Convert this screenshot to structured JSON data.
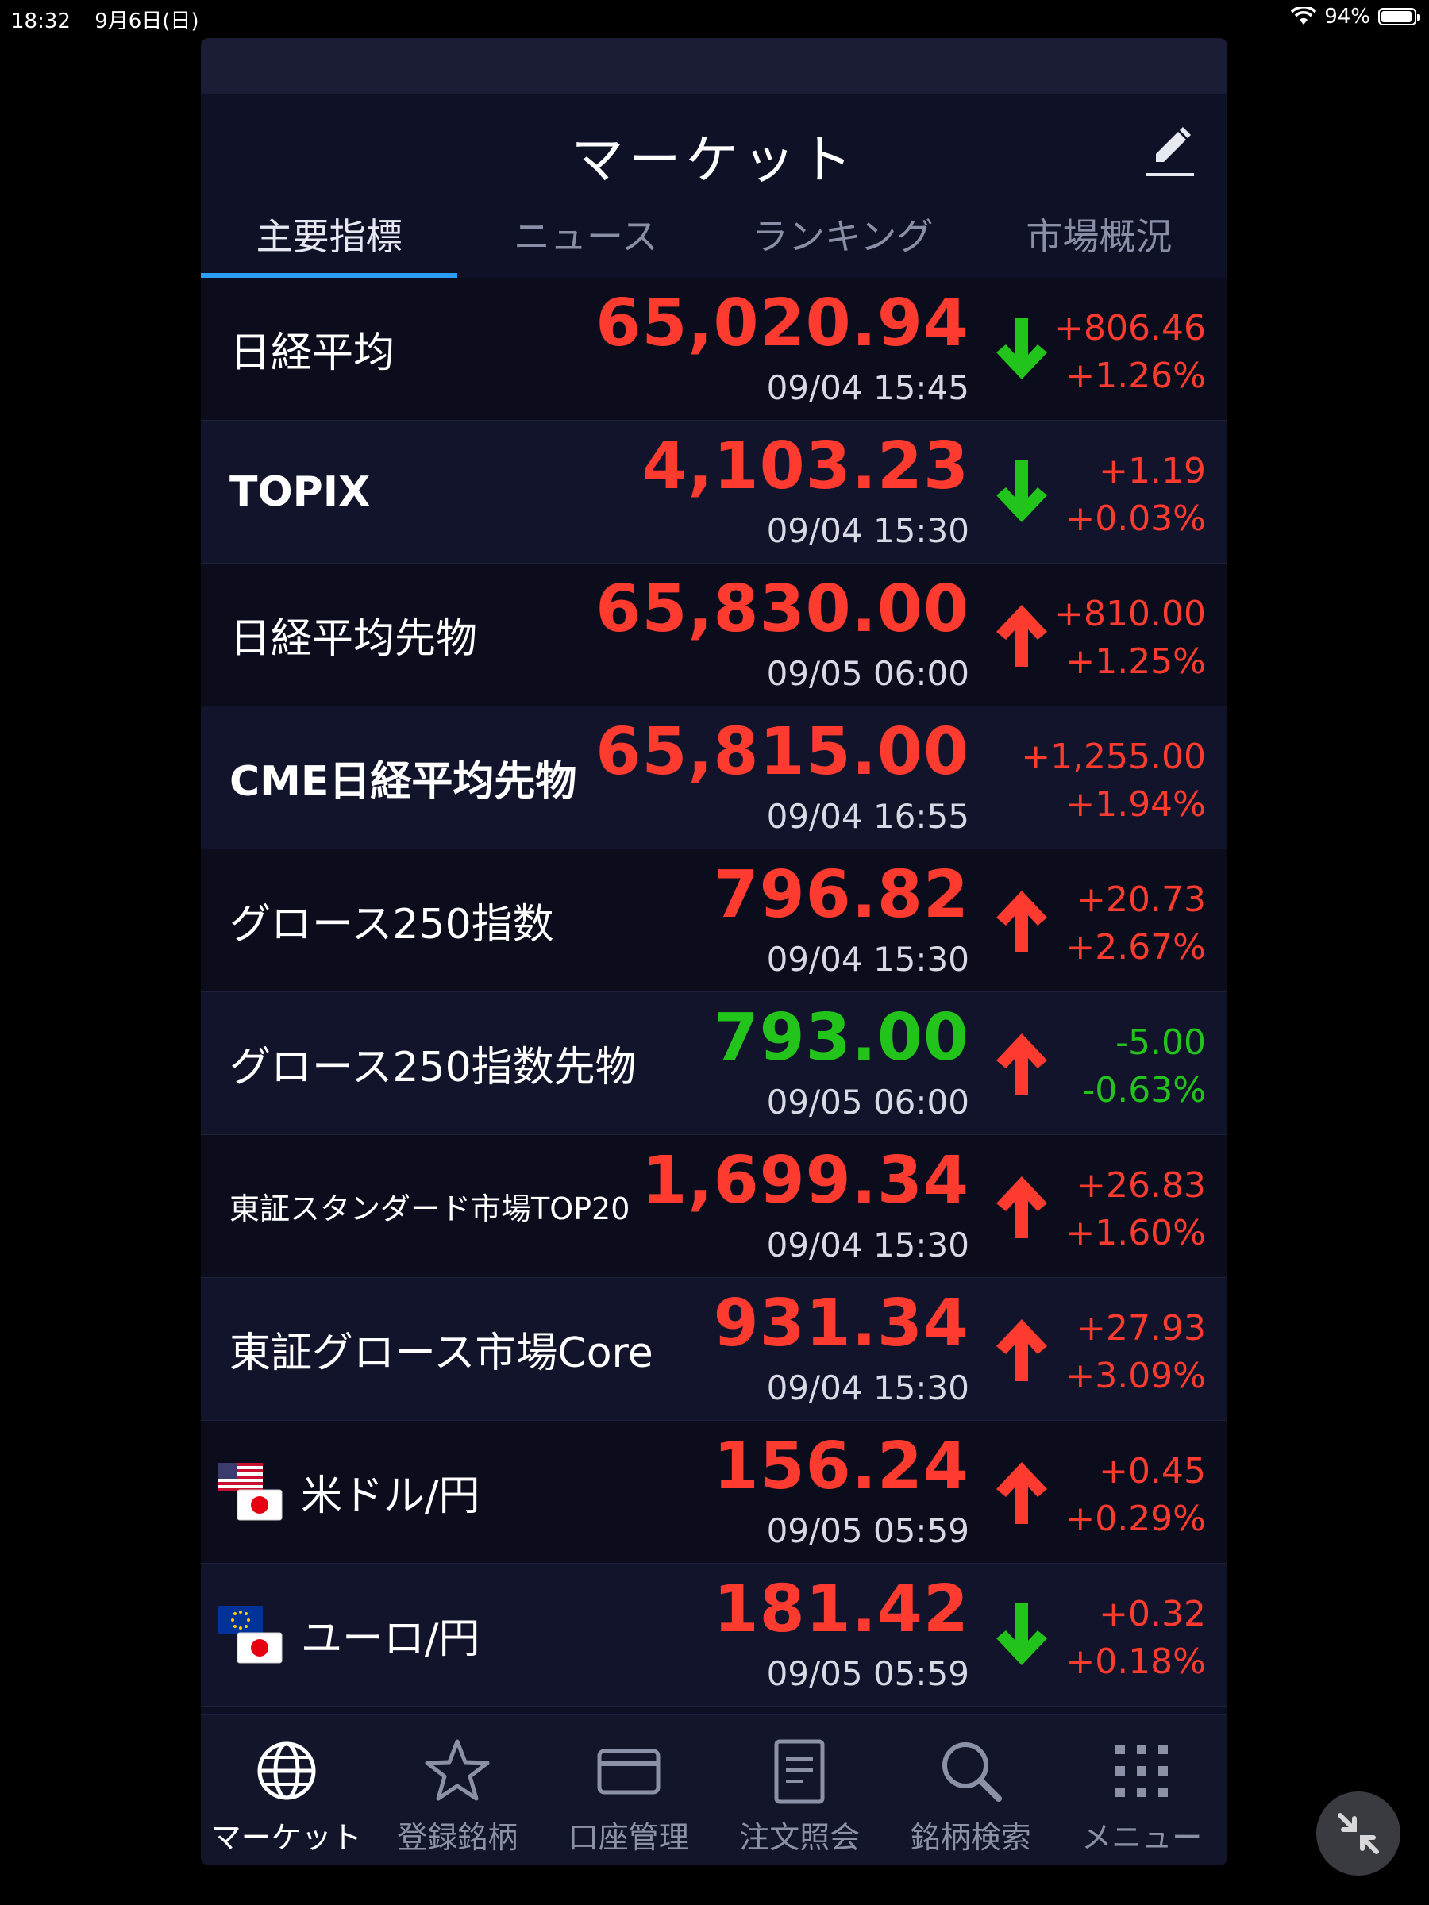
{
  "status_bar": {
    "time": "18:32",
    "date": "9月6日(日)",
    "battery": "94%",
    "battery_level": 0.94
  },
  "header": {
    "title": "マーケット"
  },
  "tabs": [
    {
      "label": "主要指標"
    },
    {
      "label": "ニュース"
    },
    {
      "label": "ランキング"
    },
    {
      "label": "市場概況"
    }
  ],
  "rows": [
    {
      "name": "日経平均",
      "price": "65,020.94",
      "time": "09/04 15:45",
      "change": "+806.46",
      "percent": "+1.26%",
      "price_color": "#ff3b30",
      "change_color": "#ff3b30",
      "trend": "down"
    },
    {
      "name": "TOPIX",
      "price": "4,103.23",
      "time": "09/04 15:30",
      "change": "+1.19",
      "percent": "+0.03%",
      "price_color": "#ff3b30",
      "change_color": "#ff3b30",
      "trend": "down"
    },
    {
      "name": "日経平均先物",
      "price": "65,830.00",
      "time": "09/05 06:00",
      "change": "+810.00",
      "percent": "+1.25%",
      "price_color": "#ff3b30",
      "change_color": "#ff3b30",
      "trend": "up"
    },
    {
      "name": "CME日経平均先物",
      "price": "65,815.00",
      "time": "09/04 16:55",
      "change": "+1,255.00",
      "percent": "+1.94%",
      "price_color": "#ff3b30",
      "change_color": "#ff3b30",
      "trend": "none"
    },
    {
      "name": "グロース250指数",
      "price": "796.82",
      "time": "09/04 15:30",
      "change": "+20.73",
      "percent": "+2.67%",
      "price_color": "#ff3b30",
      "change_color": "#ff3b30",
      "trend": "up"
    },
    {
      "name": "グロース250指数先物",
      "price": "793.00",
      "time": "09/05 06:00",
      "change": "-5.00",
      "percent": "-0.63%",
      "price_color": "#22c31b",
      "change_color": "#22c31b",
      "trend": "up"
    },
    {
      "name": "東証スタンダード市場TOP20",
      "price": "1,699.34",
      "time": "09/04 15:30",
      "change": "+26.83",
      "percent": "+1.60%",
      "price_color": "#ff3b30",
      "change_color": "#ff3b30",
      "trend": "up"
    },
    {
      "name": "東証グロース市場Core",
      "price": "931.34",
      "time": "09/04 15:30",
      "change": "+27.93",
      "percent": "+3.09%",
      "price_color": "#ff3b30",
      "change_color": "#ff3b30",
      "trend": "up"
    },
    {
      "name": "米ドル/円",
      "price": "156.24",
      "time": "09/05 05:59",
      "change": "+0.45",
      "percent": "+0.29%",
      "price_color": "#ff3b30",
      "change_color": "#ff3b30",
      "trend": "up",
      "flag": "us"
    },
    {
      "name": "ユーロ/円",
      "price": "181.42",
      "time": "09/05 05:59",
      "change": "+0.32",
      "percent": "+0.18%",
      "price_color": "#ff3b30",
      "change_color": "#ff3b30",
      "trend": "down",
      "flag": "eu"
    }
  ],
  "bottom_nav": [
    {
      "label": "マーケット",
      "icon": "globe-icon"
    },
    {
      "label": "登録銘柄",
      "icon": "star-icon"
    },
    {
      "label": "口座管理",
      "icon": "card-icon"
    },
    {
      "label": "注文照会",
      "icon": "document-icon"
    },
    {
      "label": "銘柄検索",
      "icon": "search-icon"
    },
    {
      "label": "メニュー",
      "icon": "grid-icon"
    }
  ],
  "colors": {
    "up_arrow": "#ff3b30",
    "down_arrow": "#22c31b",
    "accent": "#2a9df4"
  }
}
